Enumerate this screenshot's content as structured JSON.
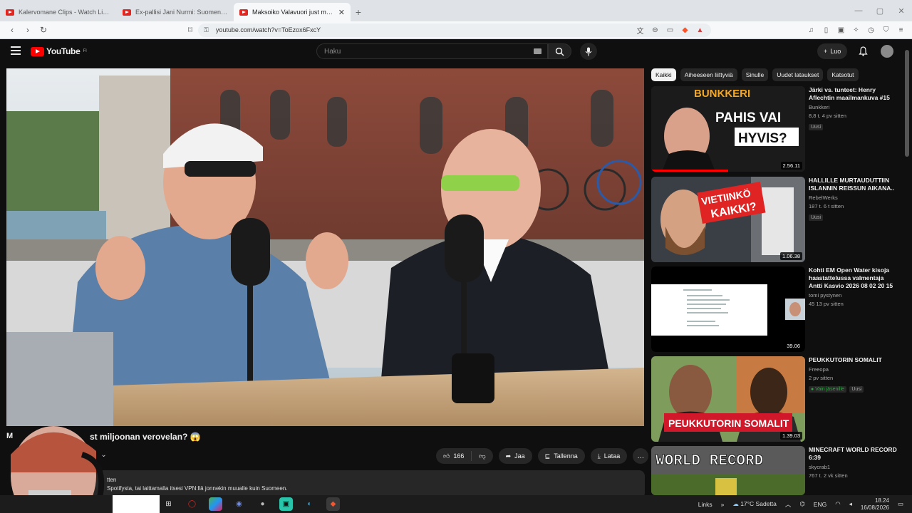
{
  "browser": {
    "tabs": [
      {
        "title": "Kalervomane Clips - Watch Live on Kick",
        "active": false
      },
      {
        "title": "Ex-pallisi Jani Nurmi: Suomen pollisi on",
        "active": false
      },
      {
        "title": "Maksoiko Valavuori just miljoonan",
        "active": true
      }
    ],
    "new_tab": "+",
    "url": "youtube.com/watch?v=ToEzox6FxcY"
  },
  "youtube": {
    "logo_text": "YouTube",
    "logo_sup": "FI",
    "search_placeholder": "Haku",
    "create_label": "Luo"
  },
  "video": {
    "title": "st miljoonan verovelan? 😱",
    "title_prefix": "M",
    "likes": "166",
    "share_label": "Jaa",
    "save_label": "Tallenna",
    "download_label": "Lataa",
    "more_label": "…",
    "desc_line1": "tten",
    "desc_line2": "Spotifysta, tai laittamalla itsesi VPN:llä jonnekin muualle kuin Suomeen."
  },
  "chips": [
    "Kaikki",
    "Aiheeseen liittyviä",
    "Sinulle",
    "Uudet lataukset",
    "Katsotut"
  ],
  "recommendations": [
    {
      "title": "Järki vs. tunteet: Henry Aflechtin maailmankuva #15",
      "channel": "Bunkkeri",
      "stats": "8,8 t.  4 pv sitten",
      "badge": "Uusi",
      "duration": "2.56.11",
      "thumb_text": "PAHIS VAI HYVIS?",
      "thumb_top": "BUNKKERI",
      "watched": 0.5
    },
    {
      "title": "HALLILLE MURTAUDUTTIIN ISLANNIN REISSUN AIKANA..",
      "channel": "RebelWerks",
      "stats": "187 t.  6 t sitten",
      "badge": "Uusi",
      "duration": "1.06.38",
      "thumb_text": "VIETIINKÖ KAIKKI?",
      "watched": 0
    },
    {
      "title": "Kohti EM Open Water kisoja haastattelussa valmentaja Antti Kasvio 2026 08 02 20 15 EEST...",
      "channel": "tomi pystynen",
      "stats": "45  13 pv sitten",
      "badge": "",
      "duration": "39.06",
      "watched": 0
    },
    {
      "title": "PEUKKUTORIN SOMALIT",
      "channel": "Freeopa",
      "stats": "2 pv sitten",
      "badge": "Uusi",
      "member_label": "Vain jäsenille",
      "duration": "1.39.03",
      "thumb_text": "PEUKKUTORIN SOMALIT",
      "watched": 0
    },
    {
      "title": "MINECRAFT WORLD RECORD 6:39",
      "channel": "skycrab1",
      "stats": "767 t.  2 vk sitten",
      "badge": "",
      "duration": "",
      "thumb_text": "WORLD RECORD",
      "watched": 0
    }
  ],
  "taskbar": {
    "links_label": "Links",
    "weather": "17°C  Sadetta",
    "lang": "ENG",
    "time": "18.24",
    "date": "16/08/2026"
  },
  "colors": {
    "brand": "#ff0000",
    "bg": "#0f0f0f",
    "chip_bg": "#272727"
  }
}
